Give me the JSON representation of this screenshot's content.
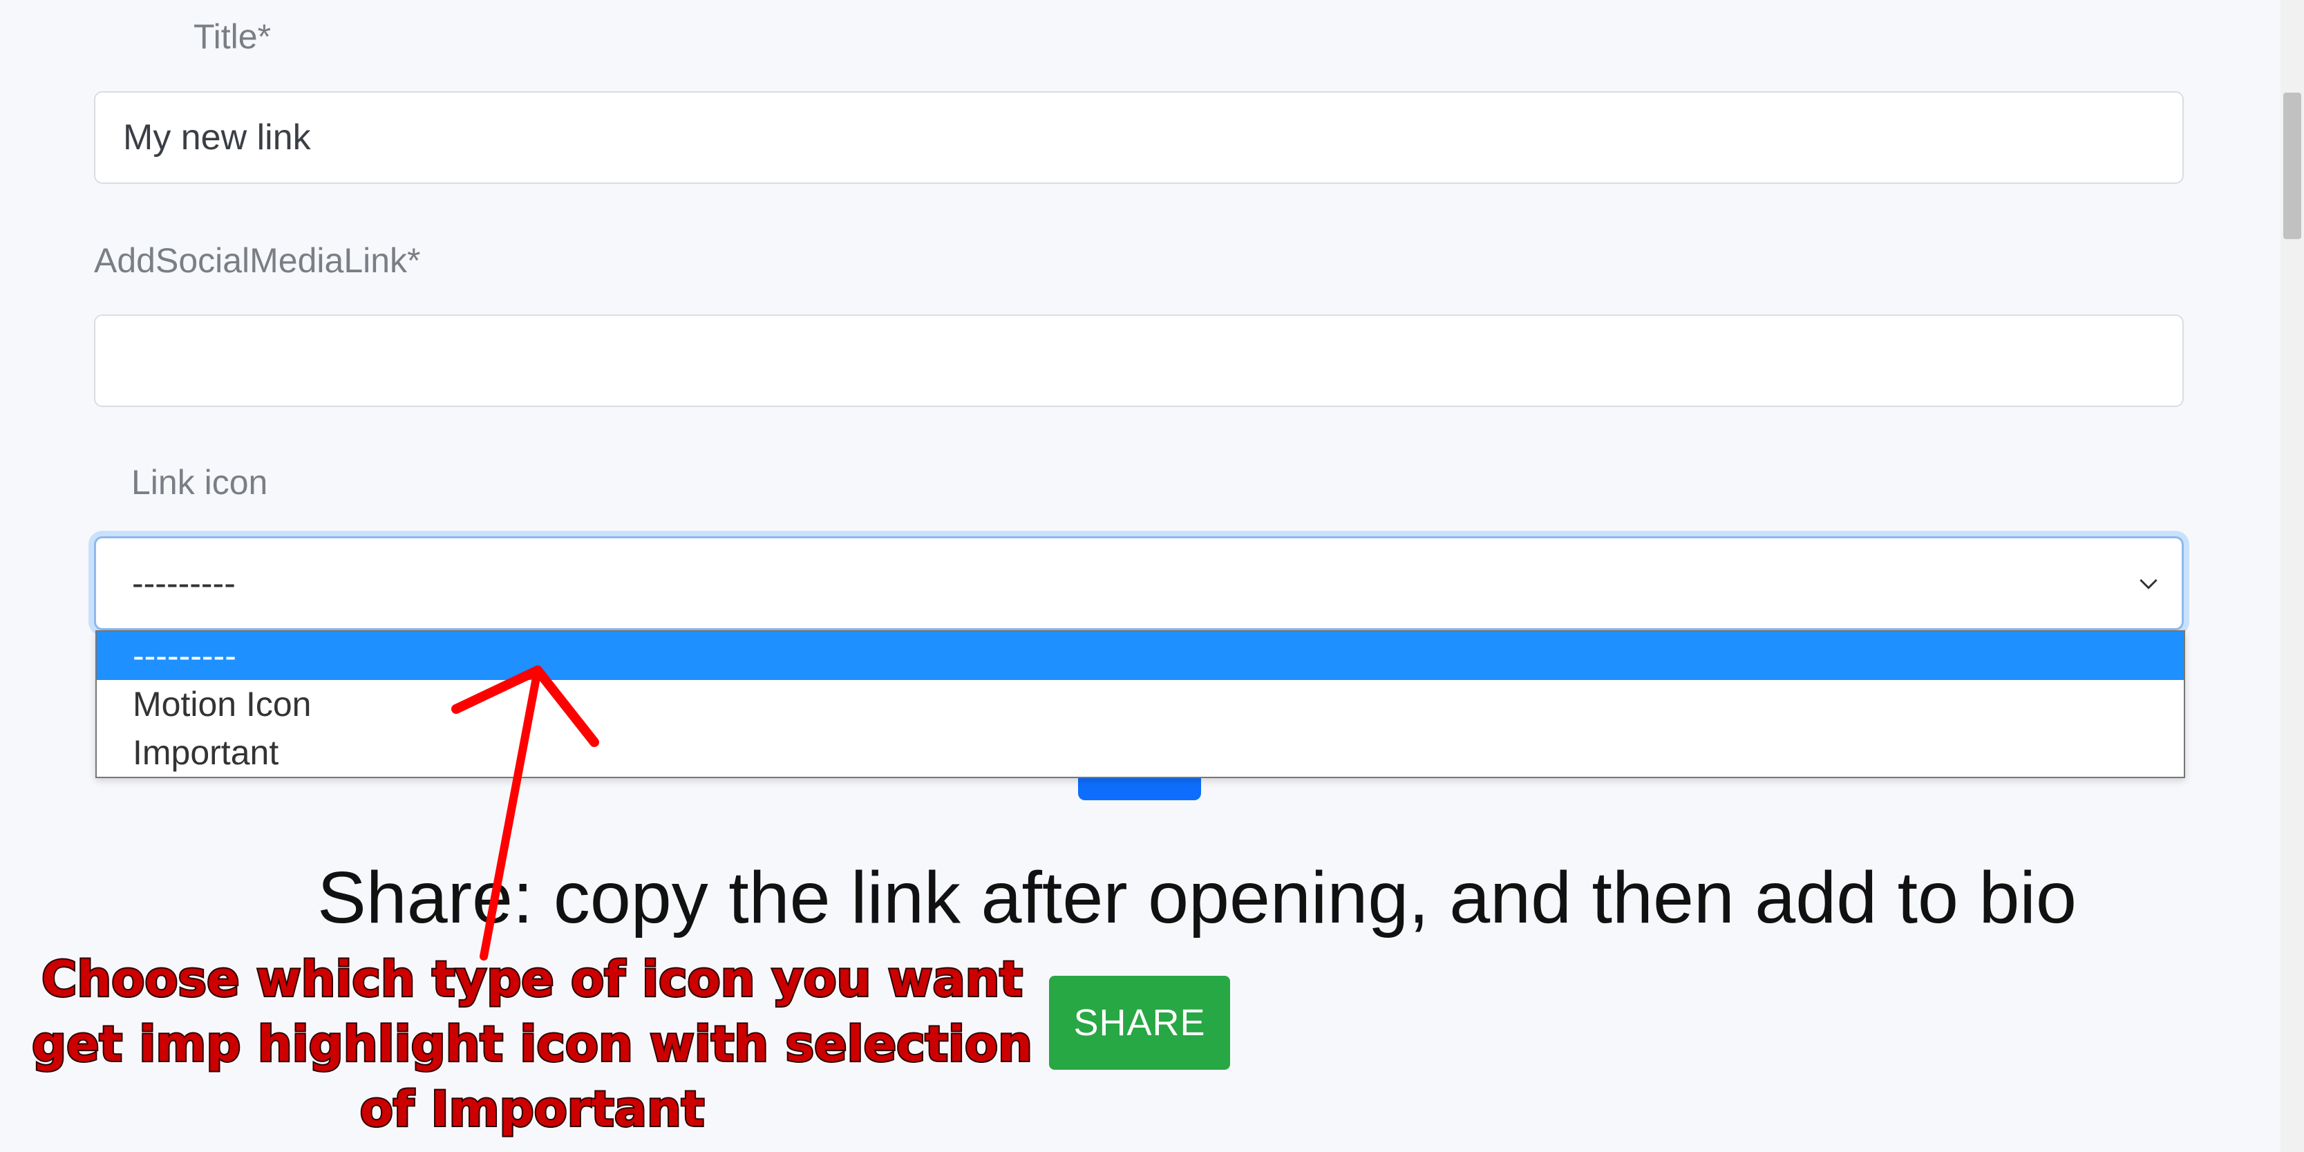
{
  "form": {
    "title_label": "Title*",
    "title_value": "My new link",
    "social_label": "AddSocialMediaLink*",
    "social_value": "",
    "icon_label": "Link icon",
    "icon_selected": "---------",
    "icon_options": [
      "---------",
      "Motion Icon",
      "Important"
    ]
  },
  "share": {
    "text": "Share: copy the link after opening, and then add to bio",
    "button_label": "SHARE"
  },
  "annotation": {
    "line1": "Choose which type of icon you want",
    "line2": "get imp highlight icon with selection",
    "line3": "of Important"
  },
  "colors": {
    "accent_blue": "#1e90ff",
    "share_green": "#28a745",
    "annotation_red": "#ff0000"
  }
}
